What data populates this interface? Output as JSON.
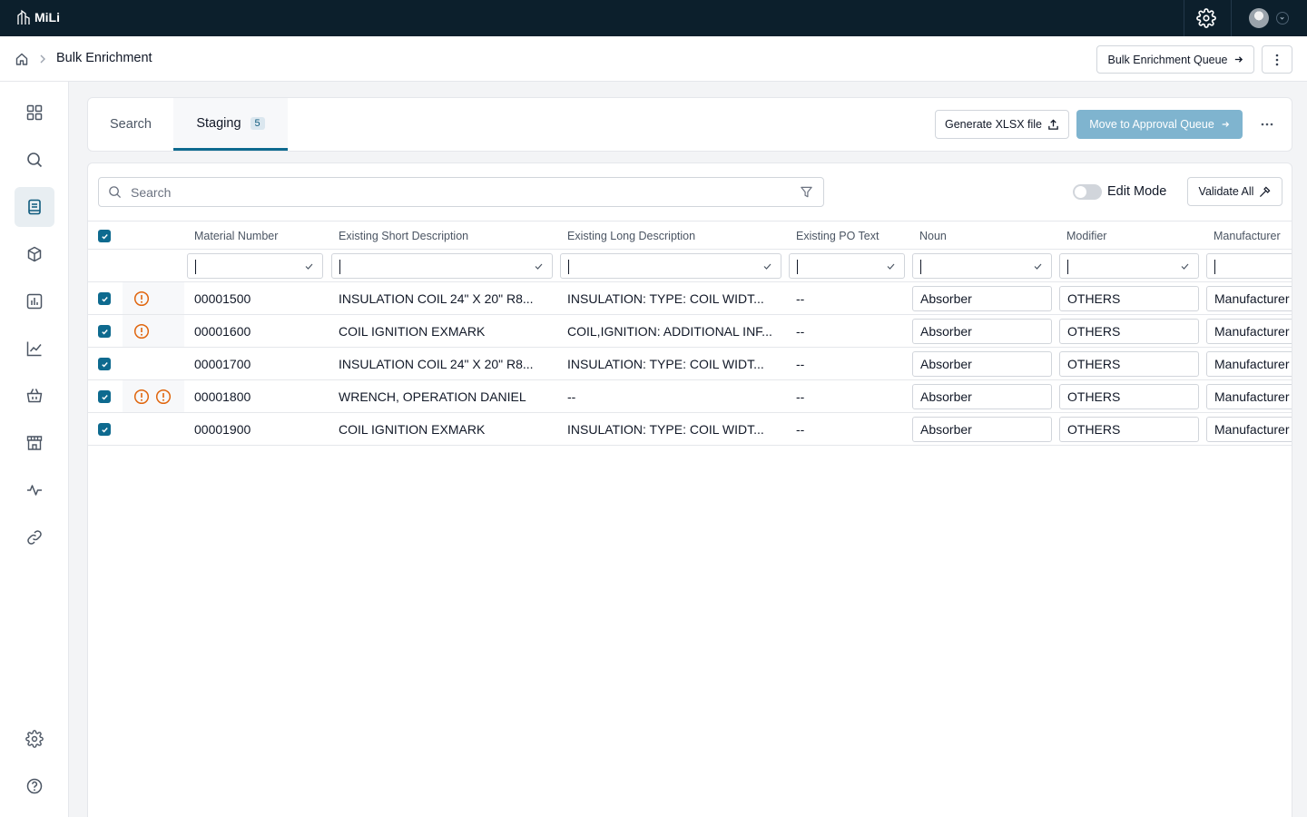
{
  "app": {
    "logo_text": "MiLi"
  },
  "breadcrumb": {
    "title": "Bulk Enrichment"
  },
  "header": {
    "queue_button": "Bulk Enrichment Queue"
  },
  "tabs": {
    "search_label": "Search",
    "staging_label": "Staging",
    "staging_count": "5"
  },
  "toolbar": {
    "generate_label": "Generate XLSX file",
    "move_label": "Move to Approval Queue"
  },
  "table_toolbar": {
    "search_placeholder": "Search",
    "edit_mode_label": "Edit Mode",
    "validate_label": "Validate All"
  },
  "columns": {
    "material": "Material Number",
    "short_desc": "Existing Short Description",
    "long_desc": "Existing Long Description",
    "po_text": "Existing PO Text",
    "noun": "Noun",
    "modifier": "Modifier",
    "manufacturer": "Manufacturer"
  },
  "rows": [
    {
      "material": "00001500",
      "short": "INSULATION COIL 24\" X 20\" R8...",
      "long": "INSULATION: TYPE: COIL WIDT...",
      "po": "--",
      "noun": "Absorber",
      "modifier": "OTHERS",
      "manufacturer": "Manufacturer",
      "warnings": 1
    },
    {
      "material": "00001600",
      "short": "COIL IGNITION EXMARK",
      "long": "COIL,IGNITION: ADDITIONAL INF...",
      "po": "--",
      "noun": "Absorber",
      "modifier": "OTHERS",
      "manufacturer": "Manufacturer",
      "warnings": 1
    },
    {
      "material": "00001700",
      "short": "INSULATION COIL 24\" X 20\" R8...",
      "long": "INSULATION: TYPE: COIL WIDT...",
      "po": "--",
      "noun": "Absorber",
      "modifier": "OTHERS",
      "manufacturer": "Manufacturer",
      "warnings": 0
    },
    {
      "material": "00001800",
      "short": "WRENCH, OPERATION DANIEL",
      "long": "--",
      "po": "--",
      "noun": "Absorber",
      "modifier": "OTHERS",
      "manufacturer": "Manufacturer",
      "warnings": 2
    },
    {
      "material": "00001900",
      "short": "COIL IGNITION EXMARK",
      "long": "INSULATION: TYPE: COIL WIDT...",
      "po": "--",
      "noun": "Absorber",
      "modifier": "OTHERS",
      "manufacturer": "Manufacturer",
      "warnings": 0
    }
  ],
  "colors": {
    "topbar": "#0c1f2c",
    "accent": "#0e6a8f",
    "move_button": "#7fb4cf",
    "warning": "#e0660f"
  },
  "icons": [
    "home-icon",
    "gear-icon",
    "dashboard-icon",
    "search-icon",
    "catalog-icon",
    "cube-icon",
    "report-icon",
    "trend-icon",
    "basket-icon",
    "store-icon",
    "activity-icon",
    "link-icon",
    "help-icon",
    "filter-icon",
    "upload-icon",
    "arrow-right-icon",
    "kebab-icon",
    "warning-icon"
  ]
}
